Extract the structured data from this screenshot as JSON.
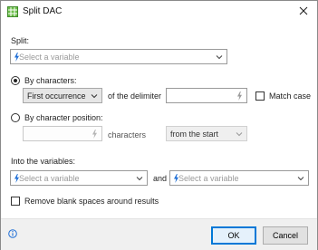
{
  "window": {
    "title": "Split DAC",
    "close_icon": "close-icon",
    "app_icon": "split-dac-icon"
  },
  "split": {
    "label": "Split:",
    "placeholder": "Select a variable"
  },
  "by_characters": {
    "label": "By characters:",
    "selected": true,
    "occurrence_value": "First occurrence",
    "of_delimiter_label": "of the delimiter",
    "delimiter_value": "",
    "match_case_label": "Match case",
    "match_case_checked": false
  },
  "by_position": {
    "label": "By character position:",
    "selected": false,
    "position_value": "",
    "characters_label": "characters",
    "direction_value": "from the start"
  },
  "into": {
    "label": "Into the variables:",
    "first_placeholder": "Select a variable",
    "and_label": "and",
    "second_placeholder": "Select a variable"
  },
  "remove_blanks": {
    "label": "Remove blank spaces around results",
    "checked": false
  },
  "footer": {
    "ok_label": "OK",
    "cancel_label": "Cancel",
    "info_icon": "info-icon"
  },
  "colors": {
    "accent": "#0078d7",
    "variable_icon": "#1e6ed6",
    "footer_bg": "#f0f0f0"
  }
}
